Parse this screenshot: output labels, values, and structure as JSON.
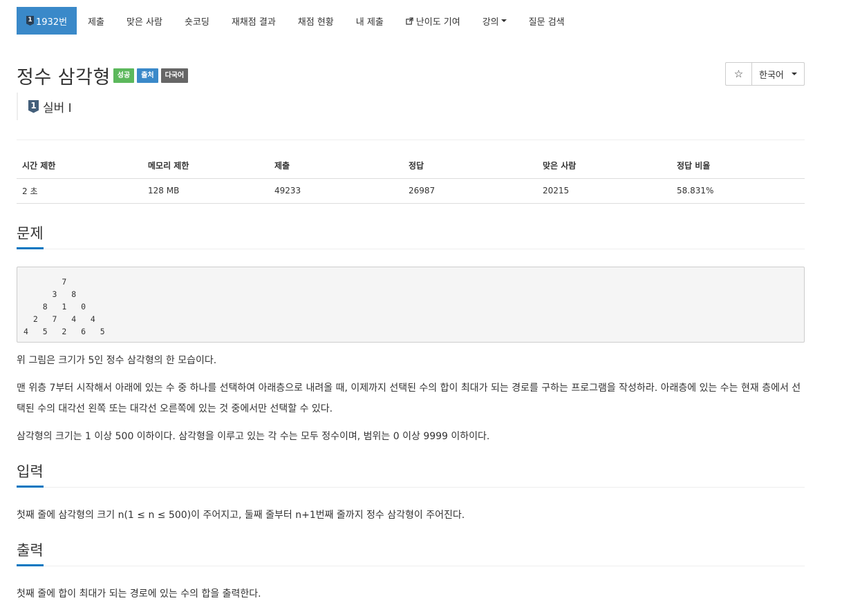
{
  "tabs": [
    {
      "label": "1932번",
      "active": true,
      "tier": "1"
    },
    {
      "label": "제출"
    },
    {
      "label": "맞은 사람"
    },
    {
      "label": "숏코딩"
    },
    {
      "label": "재채점 결과"
    },
    {
      "label": "채점 현황"
    },
    {
      "label": "내 제출"
    },
    {
      "label": "난이도 기여",
      "icon": "external-link-icon"
    },
    {
      "label": "강의",
      "dropdown": true
    },
    {
      "label": "질문 검색"
    }
  ],
  "problem": {
    "title": "정수 삼각형",
    "labels": [
      "성공",
      "출처",
      "다국어"
    ],
    "tier_number": "1",
    "tier_name": "실버 I"
  },
  "controls": {
    "star": "☆",
    "language": "한국어"
  },
  "stats": {
    "headers": [
      "시간 제한",
      "메모리 제한",
      "제출",
      "정답",
      "맞은 사람",
      "정답 비율"
    ],
    "values": [
      "2 초",
      "128 MB",
      "49233",
      "26987",
      "20215",
      "58.831%"
    ]
  },
  "sections": {
    "problem_heading": "문제",
    "triangle": "        7\n      3   8\n    8   1   0\n  2   7   4   4\n4   5   2   6   5",
    "problem_p1": "위 그림은 크기가 5인 정수 삼각형의 한 모습이다.",
    "problem_p2": "맨 위층 7부터 시작해서 아래에 있는 수 중 하나를 선택하여 아래층으로 내려올 때, 이제까지 선택된 수의 합이 최대가 되는 경로를 구하는 프로그램을 작성하라. 아래층에 있는 수는 현재 층에서 선택된 수의 대각선 왼쪽 또는 대각선 오른쪽에 있는 것 중에서만 선택할 수 있다.",
    "problem_p3": "삼각형의 크기는 1 이상 500 이하이다. 삼각형을 이루고 있는 각 수는 모두 정수이며, 범위는 0 이상 9999 이하이다.",
    "input_heading": "입력",
    "input_p": "첫째 줄에 삼각형의 크기 n(1 ≤ n ≤ 500)이 주어지고, 둘째 줄부터 n+1번째 줄까지 정수 삼각형이 주어진다.",
    "output_heading": "출력",
    "output_p": "첫째 줄에 합이 최대가 되는 경로에 있는 수의 합을 출력한다."
  },
  "colors": {
    "accent": "#3a89c9",
    "success": "#5cb85c",
    "tier_silver": "#435f7a",
    "heading_underline": "#0076c0"
  }
}
